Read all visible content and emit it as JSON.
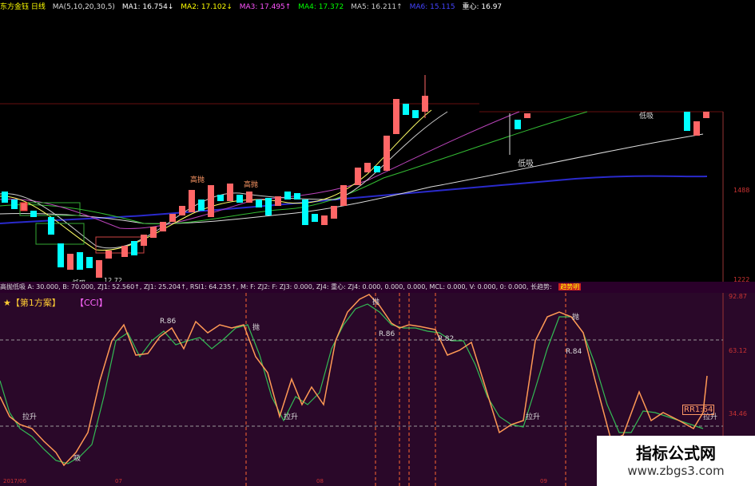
{
  "header": {
    "title": "东方金钰 日线",
    "ma_params": "MA(5,10,20,30,5)",
    "ma1": "MA1: 16.754↓",
    "ma2": "MA2: 17.102↓",
    "ma3": "MA3: 17.495↑",
    "ma4": "MA4: 17.372",
    "ma5": "MA5: 16.211↑",
    "ma6": "MA6: 15.115",
    "center": "重心: 16.97",
    "colors": {
      "title": "#ffff00",
      "ma1": "#ffffff",
      "ma2": "#ffff00",
      "ma3": "#ff00ff",
      "ma4": "#00ff00",
      "ma5": "#aaaaaa",
      "ma6": "#4444ff"
    }
  },
  "main_chart": {
    "annotations": {
      "gaopao1": "高抛",
      "gaopao2": "高抛",
      "dixi1": "低吸",
      "dixi2": "低吸",
      "dixi3": "低吸",
      "low_price": "12.72"
    },
    "price_ticks": [
      "1488",
      "1222"
    ]
  },
  "sub_header": {
    "label": "高抛低吸 A: 30.000, B: 70.000, ZJ1: 52.560↑, ZJ1: 25.204↑, RSI1: 64.235↑, M: F: ZJ2: F: ZJ3: 0.000, ZJ4: 重心: ZJ4: 0.000, 0.000, 0.000, MCL: 0.000, V: 0.000, 0: 0.000, 长趋势:",
    "tag": "趋势明"
  },
  "sub_chart": {
    "title_left": "★【第1方案】",
    "title_cci": "【CCI】",
    "y_ticks": [
      "92.87",
      "63.12",
      "34.46"
    ],
    "rr_label": "RR1:64",
    "markers": {
      "pao": "抛",
      "r86a": "R.86",
      "r86b": "R.86",
      "r84": "R.84",
      "r82": "R.82",
      "lasheng": "拉升",
      "xi": "吸"
    }
  },
  "bottom_axis": {
    "date1": "2017/06",
    "date2": "07",
    "date3": "08",
    "date4": "09"
  },
  "watermark": {
    "title": "指标公式网",
    "url": "www.zbgs3.com"
  }
}
